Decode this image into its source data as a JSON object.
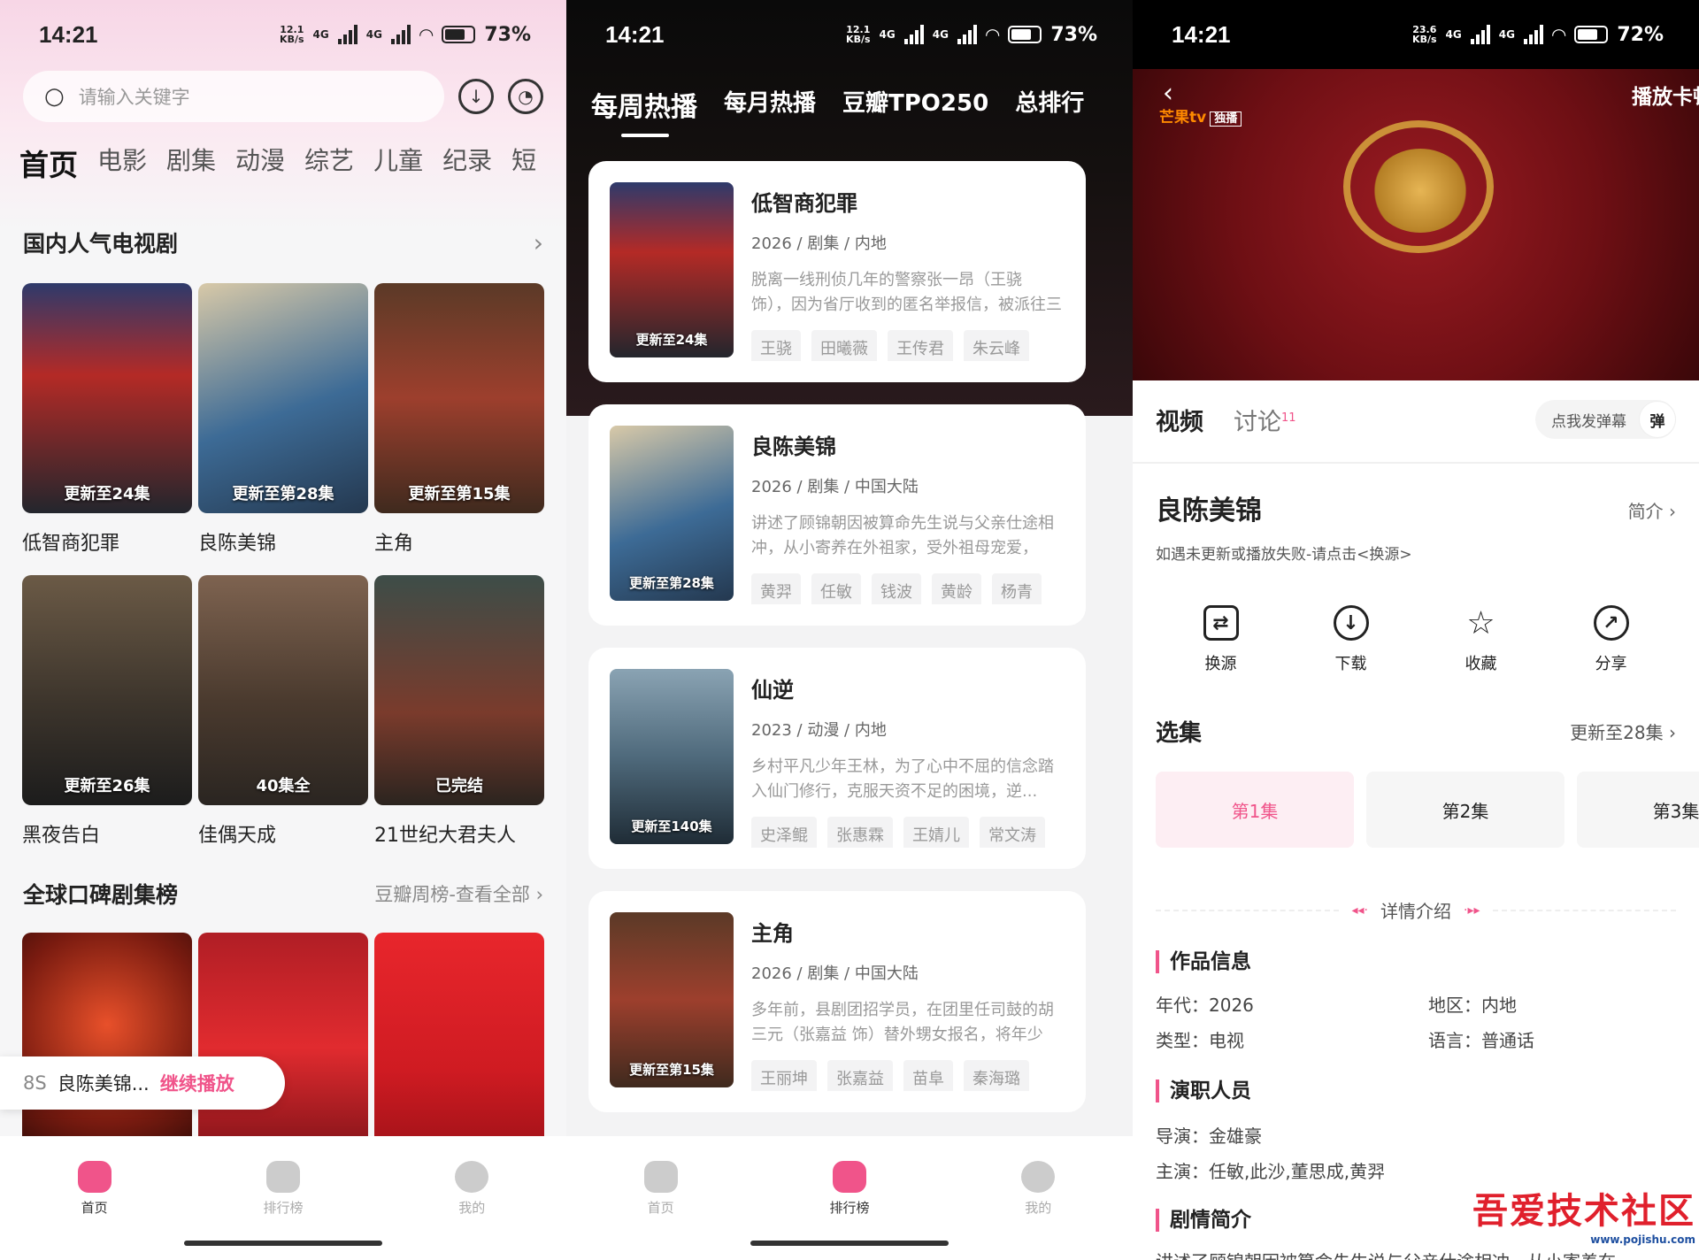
{
  "screen1": {
    "status": {
      "time": "14:21",
      "net": "12.1 KB/s",
      "net_top": "12.1",
      "net_bottom": "KB/s",
      "sig1": "4G",
      "sig2": "4G",
      "battery": "73%"
    },
    "search": {
      "placeholder": "请输入关键字"
    },
    "categories": [
      "首页",
      "电影",
      "剧集",
      "动漫",
      "综艺",
      "儿童",
      "纪录",
      "短"
    ],
    "section1": {
      "title": "国内人气电视剧",
      "more": "›",
      "items": [
        {
          "name": "低智商犯罪",
          "badge": "更新至24集"
        },
        {
          "name": "良陈美锦",
          "badge": "更新至第28集"
        },
        {
          "name": "主角",
          "badge": "更新至第15集"
        },
        {
          "name": "黑夜告白",
          "badge": "更新至26集"
        },
        {
          "name": "佳偶天成",
          "badge": "40集全"
        },
        {
          "name": "21世纪大君夫人",
          "badge": "已完结"
        }
      ]
    },
    "section2": {
      "title": "全球口碑剧集榜",
      "more": "豆瓣周榜-查看全部 ›"
    },
    "continue": {
      "time": "8S",
      "name": "良陈美锦...",
      "action": "继续播放"
    },
    "tabs": [
      "首页",
      "排行榜",
      "我的"
    ]
  },
  "screen2": {
    "status": {
      "time": "14:21",
      "net": "12.1 KB/s",
      "net_top": "12.1",
      "net_bottom": "KB/s",
      "sig1": "4G",
      "sig2": "4G",
      "battery": "73%"
    },
    "rank_tabs": [
      "每周热播",
      "每月热播",
      "豆瓣TPO250",
      "总排行"
    ],
    "cards": [
      {
        "title": "低智商犯罪",
        "meta": "2026 / 剧集 / 内地",
        "desc": "脱离一线刑侦几年的警察张一昂（王骁 饰），因为省厅收到的匿名举报信，被派往三江口...",
        "badge": "更新至24集",
        "cast": [
          "王骁",
          "田曦薇",
          "王传君",
          "朱云峰"
        ]
      },
      {
        "title": "良陈美锦",
        "meta": "2026 / 剧集 / 中国大陆",
        "desc": "讲述了顾锦朝因被算命先生说与父亲仕途相冲，从小寄养在外祖家，受外祖母宠爱，性...",
        "badge": "更新至第28集",
        "cast": [
          "黄羿",
          "任敏",
          "钱波",
          "黄龄",
          "杨青"
        ]
      },
      {
        "title": "仙逆",
        "meta": "2023 / 动漫 / 内地",
        "desc": "乡村平凡少年王林，为了心中不屈的信念踏入仙门修行，克服天资不足的困境，逆...",
        "badge": "更新至140集",
        "cast": [
          "史泽鲲",
          "张惠霖",
          "王婧儿",
          "常文涛"
        ]
      },
      {
        "title": "主角",
        "meta": "2026 / 剧集 / 中国大陆",
        "desc": "多年前，县剧团招学员，在团里任司鼓的胡三元（张嘉益 饰）替外甥女报名，将年少的...",
        "badge": "更新至第15集",
        "cast": [
          "王丽坤",
          "张嘉益",
          "苗阜",
          "秦海璐"
        ]
      }
    ],
    "tabs": [
      "首页",
      "排行榜",
      "我的"
    ]
  },
  "screen3": {
    "status": {
      "time": "14:21",
      "net": "23.6 KB/s",
      "net_top": "23.6",
      "net_bottom": "KB/s",
      "sig1": "4G",
      "sig2": "4G",
      "battery": "72%"
    },
    "player": {
      "logo_brand": "芒果tv",
      "logo_tag": "独播",
      "stuck_label": "播放卡顿"
    },
    "tabs": {
      "video": "视频",
      "discuss": "讨论",
      "discuss_count": "11",
      "danmu": "点我发弹幕",
      "danmu_btn": "弹"
    },
    "title": "良陈美锦",
    "brief": "简介 ›",
    "hint": "如遇未更新或播放失败-请点击<换源>",
    "actions": [
      "换源",
      "下载",
      "收藏",
      "分享"
    ],
    "episodes": {
      "title": "选集",
      "status": "更新至28集 ›",
      "items": [
        "第1集",
        "第2集",
        "第3集"
      ]
    },
    "detail_title": "详情介绍",
    "work_info": {
      "title": "作品信息",
      "year": "年代：2026",
      "region": "地区：内地",
      "type": "类型：电视",
      "lang": "语言：普通话"
    },
    "crew": {
      "title": "演职人员",
      "director": "导演：金雄豪",
      "cast": "主演：任敏,此沙,董思成,黄羿"
    },
    "plot": {
      "title": "剧情简介",
      "text": "讲述了顾锦朝因被算命先生说与父亲仕途相冲，从小寄养在"
    },
    "watermark": {
      "name": "吾爱技术社区",
      "url": "www.pojishu.com"
    }
  },
  "colors": {
    "accent": "#f0548a"
  }
}
